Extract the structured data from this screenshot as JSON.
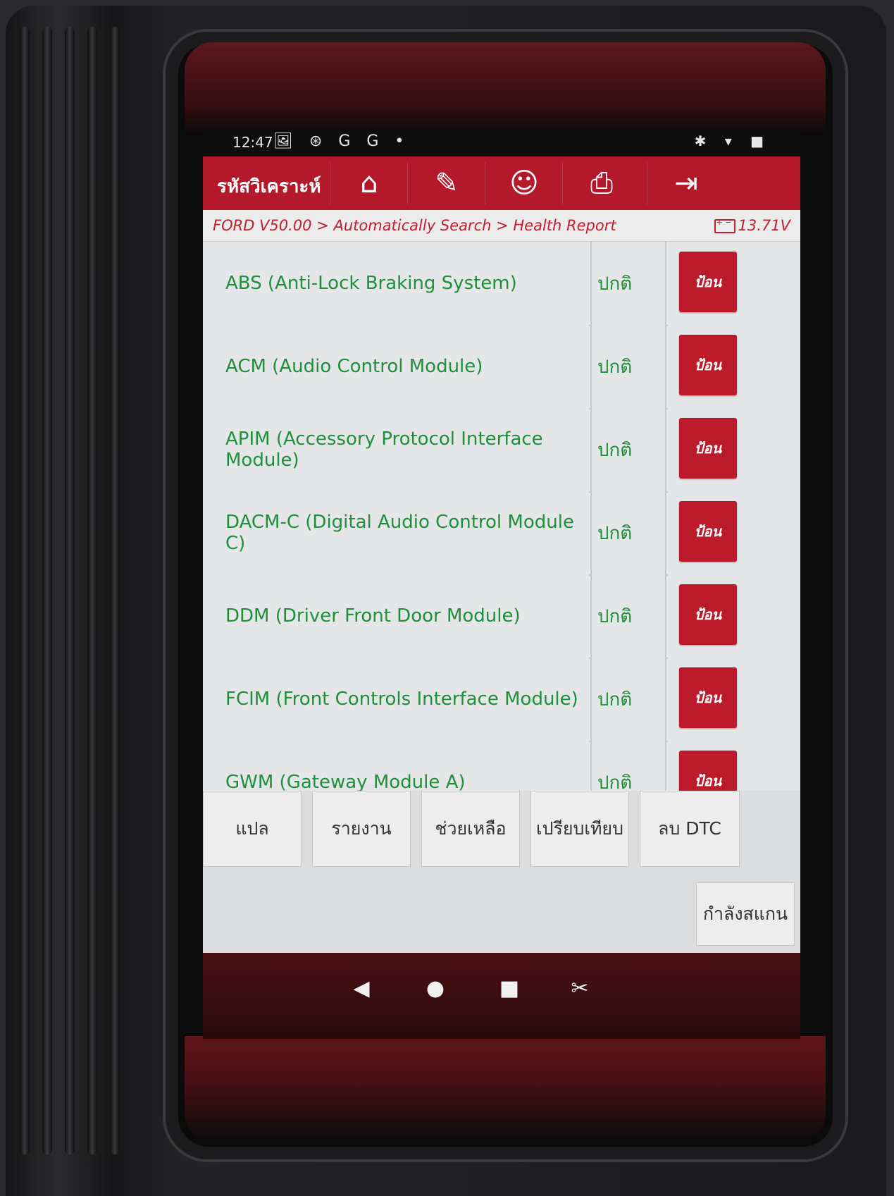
{
  "status_bar": {
    "time": "12:47",
    "left_icons": "🖼 ⊛ G G •",
    "right_icons": "✱ ▾ ■"
  },
  "title_bar": {
    "title": "รหัสวิเคราะห์",
    "buttons": [
      {
        "name": "home",
        "icon": "home-icon",
        "glyph": "⌂"
      },
      {
        "name": "edit",
        "icon": "edit-icon",
        "glyph": "✎"
      },
      {
        "name": "support",
        "icon": "user-icon",
        "glyph": "☺"
      },
      {
        "name": "print",
        "icon": "printer-icon",
        "glyph": "⎙"
      },
      {
        "name": "exit",
        "icon": "exit-icon",
        "glyph": "⇥"
      }
    ]
  },
  "breadcrumb": "FORD V50.00 > Automatically Search > Health Report",
  "voltage": "13.71V",
  "rows": [
    {
      "name": "ABS (Anti-Lock Braking System)",
      "status": "ปกติ",
      "action": "ป้อน"
    },
    {
      "name": "ACM (Audio Control Module)",
      "status": "ปกติ",
      "action": "ป้อน"
    },
    {
      "name": "APIM (Accessory Protocol Interface Module)",
      "status": "ปกติ",
      "action": "ป้อน"
    },
    {
      "name": "DACM-C (Digital Audio Control Module C)",
      "status": "ปกติ",
      "action": "ป้อน"
    },
    {
      "name": "DDM (Driver Front Door Module)",
      "status": "ปกติ",
      "action": "ป้อน"
    },
    {
      "name": "FCIM (Front Controls Interface Module)",
      "status": "ปกติ",
      "action": "ป้อน"
    },
    {
      "name": "GWM (Gateway Module A)",
      "status": "ปกติ",
      "action": "ป้อน"
    }
  ],
  "bottom_buttons": [
    "แปล",
    "รายงาน",
    "ช่วยเหลือ",
    "เปรียบเทียบ",
    "ลบ DTC"
  ],
  "scan_button": "กำลังสแกน",
  "nav": {
    "back": "◀",
    "home": "●",
    "recents": "■",
    "screenshot": "✂"
  },
  "colors": {
    "brand_red": "#b3192a",
    "status_green": "#1f8f3c",
    "button_red": "#bb1b2a"
  }
}
